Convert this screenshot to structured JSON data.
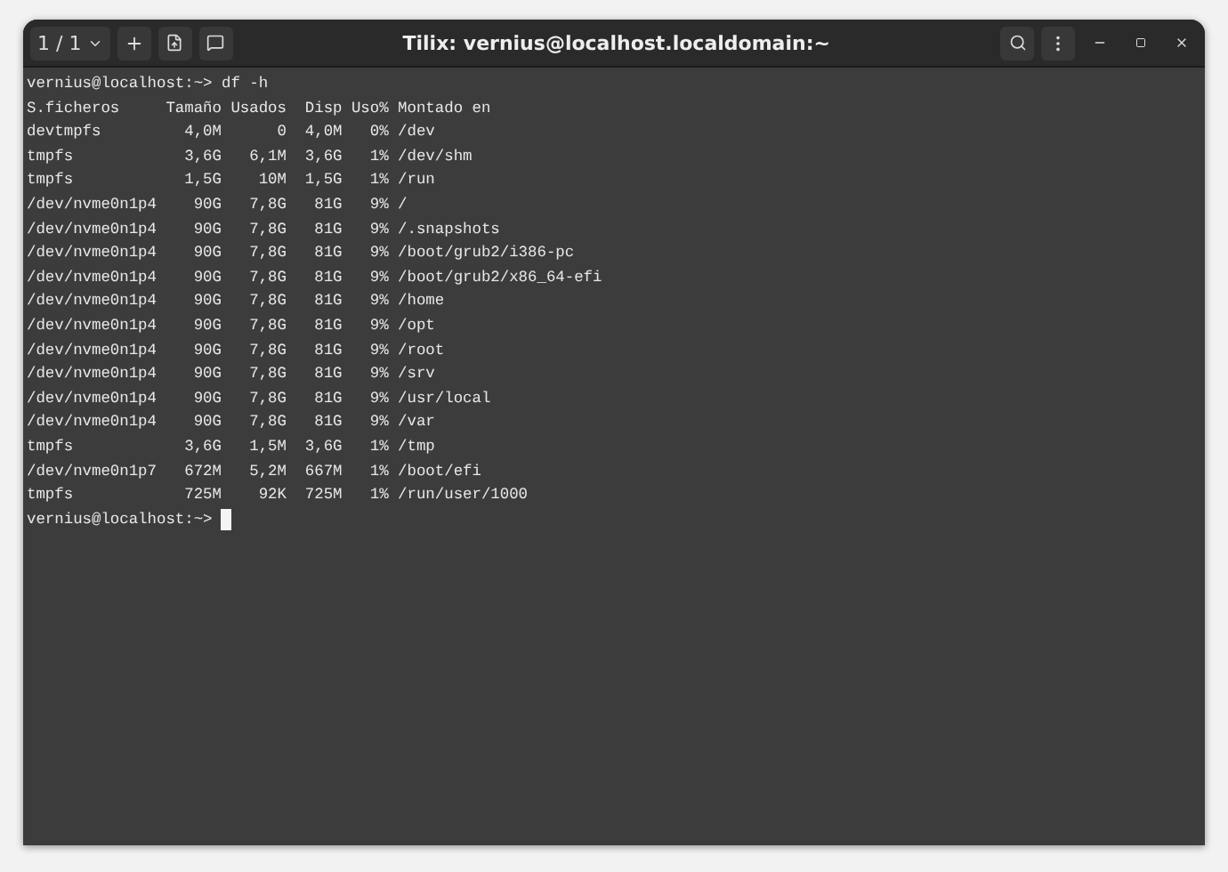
{
  "window": {
    "title": "Tilix: vernius@localhost.localdomain:~",
    "session_counter": "1 / 1"
  },
  "terminal": {
    "lines": [
      "vernius@localhost:~> df -h",
      "S.ficheros     Tamaño Usados  Disp Uso% Montado en",
      "devtmpfs         4,0M      0  4,0M   0% /dev",
      "tmpfs            3,6G   6,1M  3,6G   1% /dev/shm",
      "tmpfs            1,5G    10M  1,5G   1% /run",
      "/dev/nvme0n1p4    90G   7,8G   81G   9% /",
      "/dev/nvme0n1p4    90G   7,8G   81G   9% /.snapshots",
      "/dev/nvme0n1p4    90G   7,8G   81G   9% /boot/grub2/i386-pc",
      "/dev/nvme0n1p4    90G   7,8G   81G   9% /boot/grub2/x86_64-efi",
      "/dev/nvme0n1p4    90G   7,8G   81G   9% /home",
      "/dev/nvme0n1p4    90G   7,8G   81G   9% /opt",
      "/dev/nvme0n1p4    90G   7,8G   81G   9% /root",
      "/dev/nvme0n1p4    90G   7,8G   81G   9% /srv",
      "/dev/nvme0n1p4    90G   7,8G   81G   9% /usr/local",
      "/dev/nvme0n1p4    90G   7,8G   81G   9% /var",
      "tmpfs            3,6G   1,5M  3,6G   1% /tmp",
      "/dev/nvme0n1p7   672M   5,2M  667M   1% /boot/efi",
      "tmpfs            725M    92K  725M   1% /run/user/1000"
    ],
    "prompt": "vernius@localhost:~> "
  }
}
